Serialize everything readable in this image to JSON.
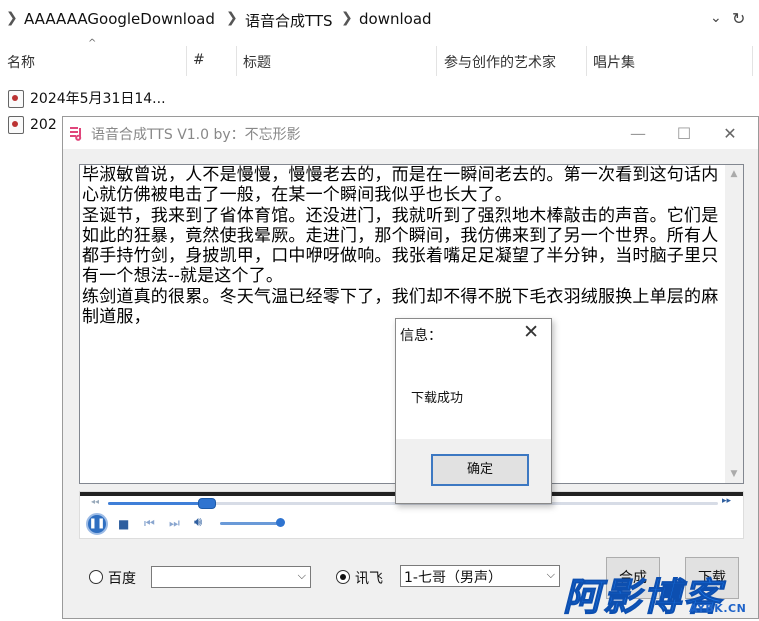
{
  "explorer": {
    "breadcrumbs": [
      "AAAAAAGoogleDownload",
      "语音合成TTS",
      "download"
    ],
    "columns": [
      "名称",
      "#",
      "标题",
      "参与创作的艺术家",
      "唱片集"
    ],
    "files": [
      "2024年5月31日14...",
      "202"
    ]
  },
  "tts_window": {
    "title": "语音合成TTS V1.0 by：不忘形影",
    "text": "毕淑敏曾说，人不是慢慢，慢慢老去的，而是在一瞬间老去的。第一次看到这句话内心就仿佛被电击了一般，在某一个瞬间我似乎也长大了。\n圣诞节，我来到了省体育馆。还没进门，我就听到了强烈地木棒敲击的声音。它们是如此的狂暴，竟然使我晕厥。走进门，那个瞬间，我仿佛来到了另一个世界。所有人都手持竹剑，身披凯甲，口中咿呀做响。我张着嘴足足凝望了半分钟，当时脑子里只有一个想法--就是这个了。\n练剑道真的很累。冬天气温已经零下了，我们却不得不脱下毛衣羽绒服换上单层的麻制道服，",
    "player": {
      "progress": 0.16,
      "volume": 0.95
    },
    "engine_baidu_label": "百度",
    "engine_baidu_value": "",
    "engine_xunfei_label": "讯飞",
    "voice_value": "1-七哥（男声）",
    "selected_engine": "讯飞",
    "synthesize_button": "合成",
    "download_button": "下载"
  },
  "dialog": {
    "title": "信息：",
    "message": "下载成功",
    "ok_button": "确定"
  },
  "watermark": {
    "main": "阿影博客",
    "sub": "AYBK.CN"
  },
  "colors": {
    "accent": "#2f74d0",
    "watermark": "#1976e8"
  }
}
